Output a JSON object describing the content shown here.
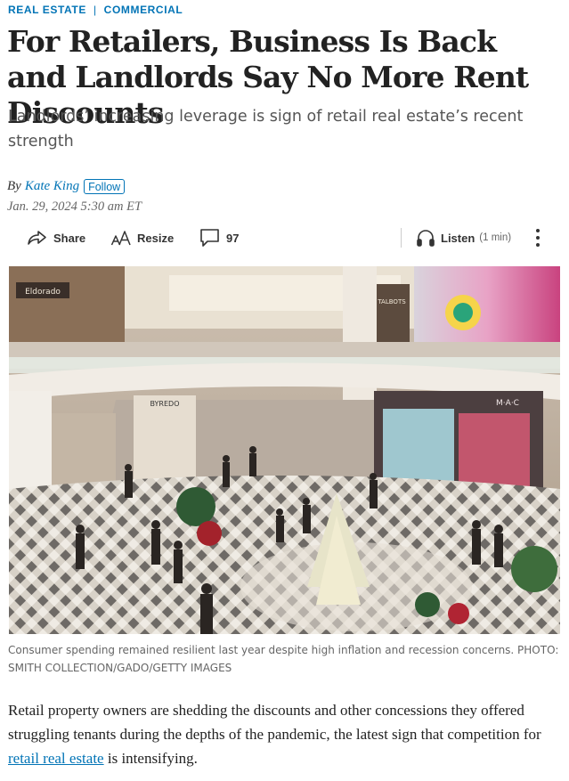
{
  "breadcrumb": {
    "section": "REAL ESTATE",
    "subsection": "COMMERCIAL"
  },
  "article": {
    "headline": "For Retailers, Business Is Back and Landlords Say No More Rent Discounts",
    "dek": "Landlords’ increasing leverage is sign of retail real estate’s recent strength",
    "byline_prefix": "By",
    "author": "Kate King",
    "follow_label": "Follow",
    "timestamp": "Jan. 29, 2024 5:30 am ET"
  },
  "toolbar": {
    "share_label": "Share",
    "resize_label": "Resize",
    "comments_count": "97",
    "listen_label": "Listen",
    "listen_duration": "(1 min)"
  },
  "photo": {
    "caption": "Consumer spending remained resilient last year despite high inflation and recession concerns. PHOTO: SMITH COLLECTION/GADO/GETTY IMAGES",
    "store_signs": [
      "Eldorado",
      "BYREDO",
      "TALBOTS",
      "M·A·C"
    ]
  },
  "body": {
    "para1_before_link": "Retail property owners are shedding the discounts and other concessions they offered struggling tenants during the depths of the pandemic, the latest sign that competition for ",
    "para1_link": "retail real estate",
    "para1_after_link": " is intensifying."
  },
  "colors": {
    "accent": "#0274b6",
    "text": "#222222",
    "muted": "#666666"
  },
  "icons": [
    "share-icon",
    "resize-icon",
    "comment-icon",
    "headphones-icon",
    "more-icon"
  ]
}
